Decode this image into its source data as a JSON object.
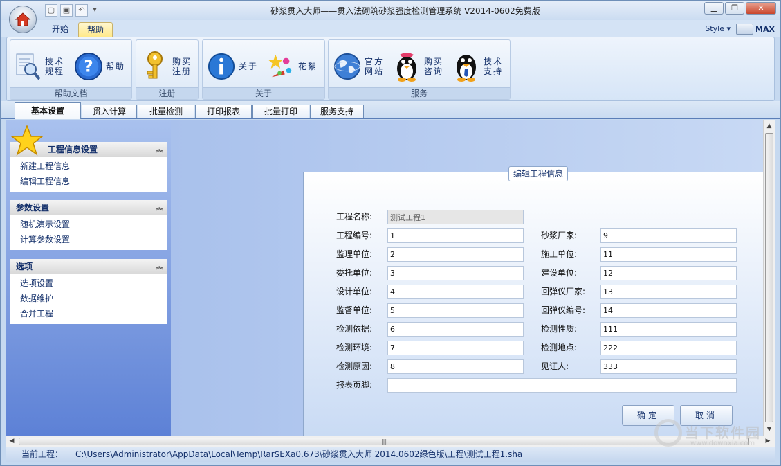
{
  "window": {
    "title": "砂浆贯入大师——贯入法砌筑砂浆强度检测管理系统  V2014-0602免费版",
    "controls": [
      "minimize-icon",
      "restore-icon",
      "close-icon"
    ]
  },
  "quick_access": [
    "new-icon",
    "save-icon",
    "undo-icon",
    "dropdown-icon"
  ],
  "ribbon_tabs": [
    {
      "label": "开始",
      "active": false
    },
    {
      "label": "帮助",
      "active": true
    }
  ],
  "style_menu": {
    "label": "Style",
    "arrow": "▾"
  },
  "max_label": "MAX",
  "ribbon_groups": [
    {
      "caption": "帮助文档",
      "buttons": [
        {
          "label": "技术\n规程",
          "icon": "magnifier-document-icon"
        },
        {
          "label": "帮助",
          "icon": "help-icon"
        }
      ]
    },
    {
      "caption": "注册",
      "buttons": [
        {
          "label": "购买\n注册",
          "icon": "key-icon"
        }
      ]
    },
    {
      "caption": "关于",
      "buttons": [
        {
          "label": "关于",
          "icon": "info-icon"
        },
        {
          "label": "花絮",
          "icon": "fireworks-icon"
        }
      ]
    },
    {
      "caption": "服务",
      "buttons": [
        {
          "label": "官方\n网站",
          "icon": "globe-icon"
        },
        {
          "label": "购买\n咨询",
          "icon": "penguin-icon"
        },
        {
          "label": "技术\n支持",
          "icon": "penguin-tie-icon"
        }
      ]
    }
  ],
  "module_tabs": [
    {
      "label": "基本设置",
      "active": true
    },
    {
      "label": "贯入计算",
      "active": false
    },
    {
      "label": "批量检测",
      "active": false
    },
    {
      "label": "打印报表",
      "active": false
    },
    {
      "label": "批量打印",
      "active": false
    },
    {
      "label": "服务支持",
      "active": false
    }
  ],
  "sidebar": {
    "sections": [
      {
        "title": "工程信息设置",
        "icon": "star-icon",
        "items": [
          "新建工程信息",
          "编辑工程信息"
        ]
      },
      {
        "title": "参数设置",
        "items": [
          "随机演示设置",
          "计算参数设置"
        ]
      },
      {
        "title": "选项",
        "items": [
          "选项设置",
          "数据维护",
          "合并工程"
        ]
      }
    ],
    "collapse_glyph": "︽"
  },
  "form": {
    "legend": "编辑工程信息",
    "project_name": {
      "label": "工程名称:",
      "value": "测试工程1"
    },
    "left_fields": [
      {
        "label": "工程编号:",
        "value": "1"
      },
      {
        "label": "监理单位:",
        "value": "2"
      },
      {
        "label": "委托单位:",
        "value": "3"
      },
      {
        "label": "设计单位:",
        "value": "4"
      },
      {
        "label": "监督单位:",
        "value": "5"
      },
      {
        "label": "检测依据:",
        "value": "6"
      },
      {
        "label": "检测环境:",
        "value": "7"
      },
      {
        "label": "检测原因:",
        "value": "8"
      }
    ],
    "right_fields": [
      {
        "label": "砂浆厂家:",
        "value": "9"
      },
      {
        "label": "施工单位:",
        "value": "11"
      },
      {
        "label": "建设单位:",
        "value": "12"
      },
      {
        "label": "回弹仪厂家:",
        "value": "13"
      },
      {
        "label": "回弹仪编号:",
        "value": "14"
      },
      {
        "label": "检测性质:",
        "value": "111"
      },
      {
        "label": "检测地点:",
        "value": "222"
      },
      {
        "label": "见证人:",
        "value": "333"
      }
    ],
    "footer": {
      "label": "报表页脚:",
      "value": ""
    },
    "ok_label": "确定",
    "cancel_label": "取消"
  },
  "status": {
    "label": "当前工程：",
    "path": "C:\\Users\\Administrator\\AppData\\Local\\Temp\\Rar$EXa0.673\\砂浆贯入大师 2014.0602绿色版\\工程\\测试工程1.sha"
  },
  "watermark": {
    "text": "当下软件园",
    "url": "www.downxia.com"
  },
  "colors": {
    "accent": "#15316b",
    "active_tab": "#ffe98a",
    "sidebar": "#5d81d6"
  }
}
